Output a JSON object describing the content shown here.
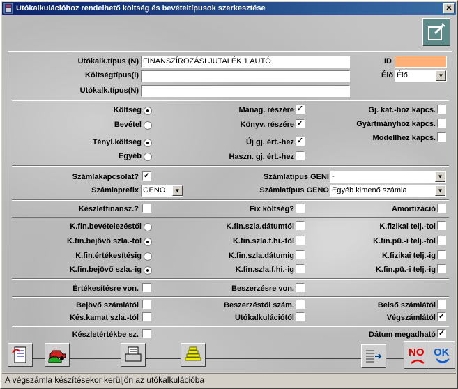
{
  "window": {
    "title": "Utókalkulációhoz rendelhető költség és bevételtípusok szerkesztése",
    "close_label": "✕"
  },
  "form": {
    "utokalk_tipus_n": {
      "label": "Utókalk.típus (N)",
      "value": "FINANSZÍROZÁSI JUTALÉK 1 AUTÓ"
    },
    "koltsegtipus_l": {
      "label": "Költségtípus(l)",
      "value": ""
    },
    "utokalk_tipus_n2": {
      "label": "Utókalk.típus(N)",
      "value": ""
    },
    "id": {
      "label": "ID",
      "value": ""
    },
    "elo": {
      "label": "Élő",
      "value": "Élő"
    }
  },
  "section1": {
    "radios": [
      {
        "label": "Költség",
        "checked": true
      },
      {
        "label": "Bevétel",
        "checked": false
      },
      {
        "label": "Tényl.költség",
        "checked": true
      },
      {
        "label": "Egyéb",
        "checked": false
      }
    ],
    "checks_mid": [
      {
        "label": "Manag. részére",
        "checked": true
      },
      {
        "label": "Könyv. részére",
        "checked": true
      },
      {
        "label": "Új gj. ért.-hez",
        "checked": true
      },
      {
        "label": "Haszn. gj. ért.-hez",
        "checked": false
      }
    ],
    "checks_right": [
      {
        "label": "Gj. kat.-hoz kapcs.",
        "checked": false
      },
      {
        "label": "Gyártmányhoz kapcs.",
        "checked": false
      },
      {
        "label": "Modellhez kapcs.",
        "checked": false
      }
    ]
  },
  "section2": {
    "szamlakapcsolat": {
      "label": "Számlakapcsolat?",
      "checked": true
    },
    "szamlaprefix": {
      "label": "Számlaprefix",
      "value": "GENO"
    },
    "szamlatipus_geni": {
      "label": "Számlatípus GENI",
      "value": "-"
    },
    "szamlatipus_geno": {
      "label": "Számlatípus GENO",
      "value": "Egyéb kimenő számla"
    }
  },
  "section3": [
    {
      "label": "Készletfinansz.?",
      "checked": false
    },
    {
      "label": "Fix költség?",
      "checked": false
    },
    {
      "label": "Amortizáció",
      "checked": false
    }
  ],
  "section4": {
    "radios": [
      {
        "label": "K.fin.bevételezéstől",
        "checked": false
      },
      {
        "label": "K.fin.bejövő szla.-tól",
        "checked": true
      },
      {
        "label": "K.fin.értékesítésig",
        "checked": false
      },
      {
        "label": "K.fin.bejövő szla.-ig",
        "checked": true
      }
    ],
    "checks_mid": [
      {
        "label": "K.fin.szla.dátumtól",
        "checked": false
      },
      {
        "label": "K.fin.szla.f.hi.-től",
        "checked": false
      },
      {
        "label": "K.fin.szla.dátumig",
        "checked": false
      },
      {
        "label": "K.fin.szla.f.hi.-ig",
        "checked": false
      }
    ],
    "checks_right": [
      {
        "label": "K.fizikai telj.-tol",
        "checked": false
      },
      {
        "label": "K.fin.pü.-i telj.-tol",
        "checked": false
      },
      {
        "label": "K.fizikai telj.-ig",
        "checked": false
      },
      {
        "label": "K.fin.pü.-i telj.-ig",
        "checked": false
      }
    ]
  },
  "section5": [
    {
      "label": "Értékesítésre von.",
      "checked": false
    },
    {
      "label": "Beszerzésre von.",
      "checked": false
    }
  ],
  "section6": [
    {
      "label": "Bejövő számlától",
      "checked": false
    },
    {
      "label": "Beszerzéstől szám.",
      "checked": false
    },
    {
      "label": "Belső számlától",
      "checked": false
    },
    {
      "label": "Kés.kamat szla.-tól",
      "checked": false
    },
    {
      "label": "Utókalkulációtól",
      "checked": false
    },
    {
      "label": "Végszámlától",
      "checked": true
    }
  ],
  "section7": [
    {
      "label": "Készletértékbe sz.",
      "checked": false
    },
    {
      "label": "Dátum megadható",
      "checked": true
    }
  ],
  "toolbar": {
    "no_label": "NO",
    "ok_label": "OK"
  },
  "status": {
    "text": "A végszámla készítésekor kerüljön az utókalkulációba"
  },
  "colors": {
    "id_field": "#ffb077",
    "title_start": "#0a246a",
    "title_end": "#3a6ea5",
    "no_red": "#e00000",
    "ok_blue": "#1060d0"
  }
}
